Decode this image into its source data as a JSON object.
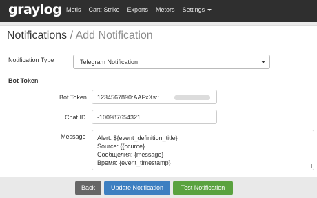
{
  "brand": "graylog",
  "nav": {
    "items": [
      "Metis",
      "Cart: Strike",
      "Exports",
      "Metors",
      "Settings"
    ]
  },
  "page": {
    "title": "Notifications",
    "separator": " / ",
    "subtitle": "Add Notification"
  },
  "form": {
    "notification_type_label": "Notification Type",
    "notification_type_value": "Telegram Notification",
    "section_label": "Bot Token",
    "bot_token_label": "Bot Token",
    "bot_token_value": "1234567890:AAFxXs::",
    "chat_id_label": "Chat ID",
    "chat_id_value": "-100987654321",
    "message_label": "Message",
    "message_lines": [
      "Alert: ${event_definition_title}",
      "Source: {{ccurce}",
      "Сообщелия: {message}",
      "Время: {event_timestamp}"
    ]
  },
  "buttons": {
    "back": "Back",
    "update": "Update Notification",
    "test": "Test Notification"
  },
  "colors": {
    "navbar": "#2f2f2f",
    "primary": "#3d7fc1",
    "success": "#5aa23f",
    "default": "#666666"
  },
  "icons": [
    "dropdown-caret-icon",
    "select-arrow-icon",
    "resize-grip-icon"
  ]
}
